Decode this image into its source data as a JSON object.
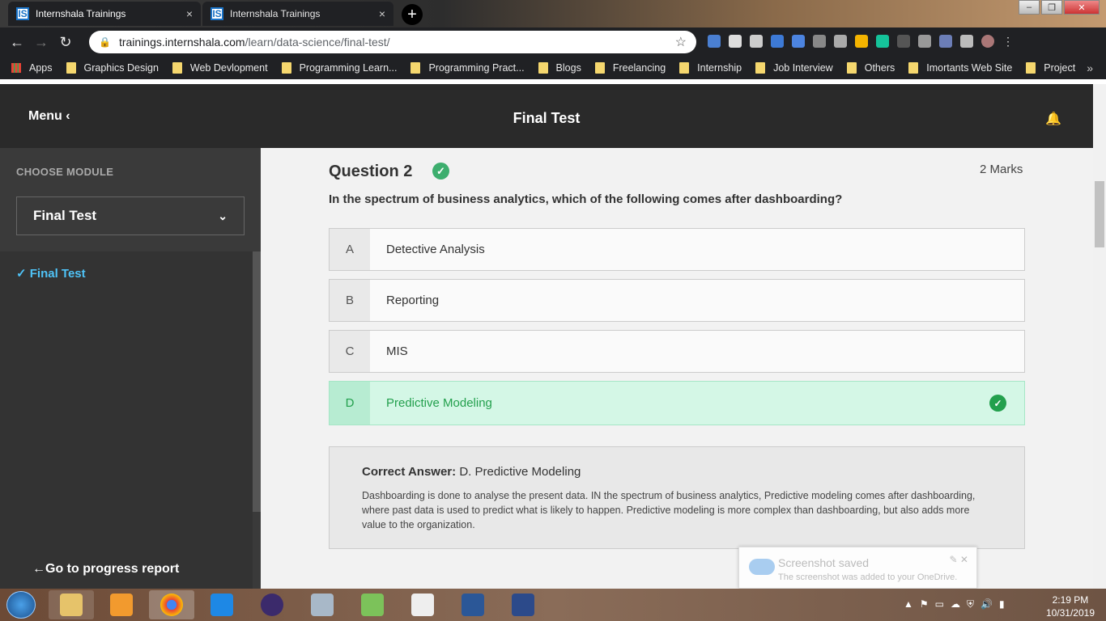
{
  "browser": {
    "tabs": [
      {
        "title": "Internshala Trainings",
        "favicon": "IS"
      },
      {
        "title": "Internshala Trainings",
        "favicon": "IS"
      }
    ],
    "close_glyph": "×",
    "new_tab_glyph": "+",
    "url_host": "trainings.internshala.com",
    "url_path": "/learn/data-science/final-test/",
    "bookmarks": [
      "Apps",
      "Graphics Design",
      "Web Devlopment",
      "Programming Learn...",
      "Programming Pract...",
      "Blogs",
      "Freelancing",
      "Internship",
      "Job Interview",
      "Others",
      "Imortants Web Site",
      "Project"
    ],
    "bookmarks_more": "»"
  },
  "header": {
    "menu_label": "Menu",
    "title": "Final Test"
  },
  "sidebar": {
    "heading": "CHOOSE MODULE",
    "selected_module": "Final Test",
    "items": [
      {
        "label": "Final Test"
      }
    ],
    "progress_link": "Go to progress report"
  },
  "question": {
    "title": "Question 2",
    "marks": "2 Marks",
    "text": "In the spectrum of business analytics, which of the following comes after dashboarding?",
    "options": [
      {
        "letter": "A",
        "text": "Detective Analysis"
      },
      {
        "letter": "B",
        "text": "Reporting"
      },
      {
        "letter": "C",
        "text": "MIS"
      },
      {
        "letter": "D",
        "text": "Predictive Modeling"
      }
    ],
    "correct_label": "Correct Answer:",
    "correct_value": "D. Predictive Modeling",
    "explanation": "Dashboarding is done to analyse the present data. IN the spectrum of business analytics, Predictive modeling comes after dashboarding, where past data is used to predict what is likely to happen. Predictive modeling is more complex than dashboarding, but also adds more value to the organization."
  },
  "toast": {
    "title": "Screenshot saved",
    "message": "The screenshot was added to your OneDrive."
  },
  "taskbar": {
    "time": "2:19 PM",
    "date": "10/31/2019"
  },
  "colors": {
    "correct_green": "#23a04d",
    "correct_bg": "#d4f7e6",
    "sidebar_link": "#4fc3f7",
    "topbar": "#2a2a2a"
  }
}
